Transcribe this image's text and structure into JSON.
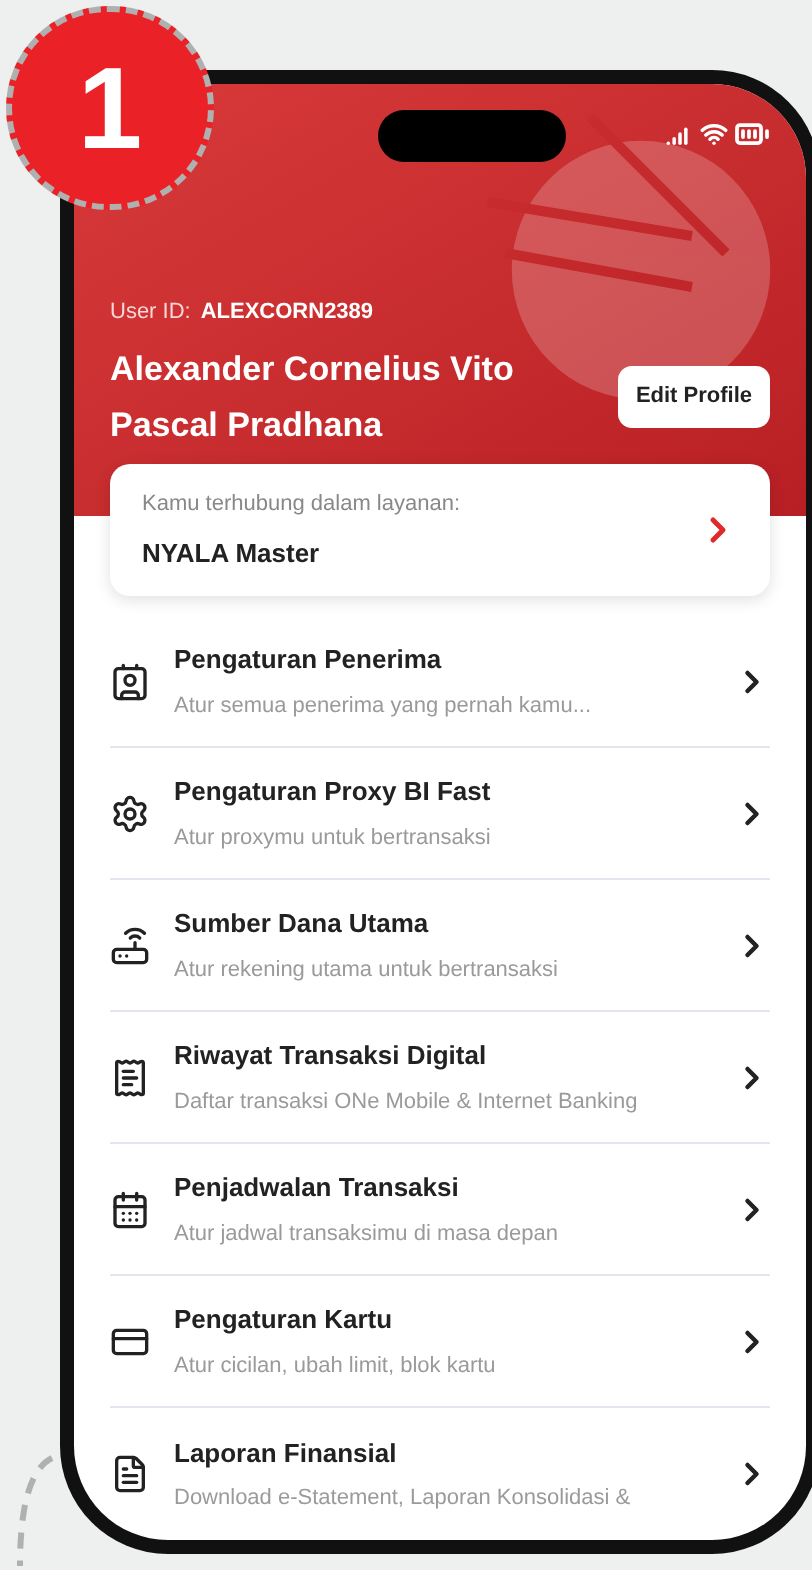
{
  "step_badge": "1",
  "header": {
    "user_id_label": "User ID:",
    "user_id": "ALEXCORN2389",
    "name": "Alexander Cornelius Vito Pascal Pradhana",
    "edit_button": "Edit Profile"
  },
  "service_card": {
    "label": "Kamu terhubung dalam layanan:",
    "value": "NYALA Master"
  },
  "menu": [
    {
      "title": "Pengaturan Penerima",
      "subtitle": "Atur semua penerima yang pernah kamu..."
    },
    {
      "title": "Pengaturan Proxy BI Fast",
      "subtitle": "Atur proxymu untuk bertransaksi"
    },
    {
      "title": "Sumber Dana Utama",
      "subtitle": "Atur rekening utama untuk bertransaksi"
    },
    {
      "title": "Riwayat Transaksi Digital",
      "subtitle": "Daftar transaksi ONe Mobile & Internet Banking"
    },
    {
      "title": "Penjadwalan Transaksi",
      "subtitle": "Atur jadwal transaksimu di masa depan"
    },
    {
      "title": "Pengaturan Kartu",
      "subtitle": "Atur cicilan, ubah limit, blok kartu"
    },
    {
      "title": "Laporan Finansial",
      "subtitle": "Download e-Statement, Laporan Konsolidasi &"
    }
  ]
}
